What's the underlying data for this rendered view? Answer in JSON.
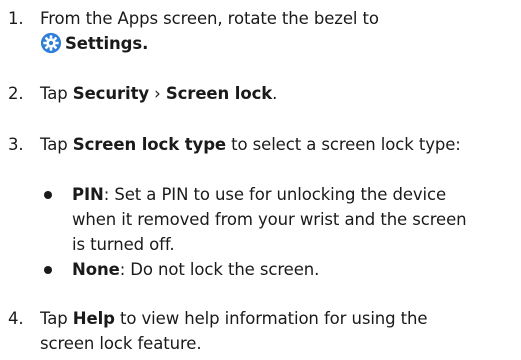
{
  "steps": [
    {
      "number": "1.",
      "line1": "From the Apps screen, rotate the bezel to",
      "settings_label": "Settings",
      "line2_end": "."
    },
    {
      "number": "2.",
      "pre": "Tap ",
      "security": "Security",
      "sep": " › ",
      "screen_lock": "Screen lock",
      "end": "."
    },
    {
      "number": "3.",
      "pre": "Tap ",
      "screen_lock_type": "Screen lock type",
      "post": " to select a screen lock type:"
    },
    {
      "number": "4.",
      "pre": "Tap ",
      "help": "Help",
      "post_line1": " to view help information for using the",
      "line2": "screen lock feature."
    }
  ],
  "bullets": [
    {
      "term": "PIN",
      "desc_line1": ": Set a PIN to use for unlocking the device",
      "desc_line2": "when it removed from your wrist and the screen",
      "desc_line3": "is turned off."
    },
    {
      "term": "None",
      "desc_line1": ": Do not lock the screen."
    }
  ],
  "icons": {
    "settings_icon_color": "#2f7fd9"
  }
}
